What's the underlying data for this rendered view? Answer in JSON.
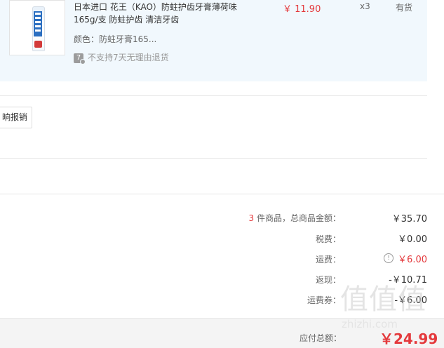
{
  "product": {
    "title_line1": "日本进口 花王（KAO）防蛀护齿牙膏薄荷味",
    "title_line2": "165g/支 防蛀护齿 清洁牙齿",
    "spec": "颜色：防蛀牙膏165...",
    "return_badge": "7",
    "return_note": "不支持7天无理由退货",
    "price": "￥ 11.90",
    "quantity": "x3",
    "stock": "有货"
  },
  "invoice": {
    "button_label": "晌报销"
  },
  "summary": {
    "count": "3",
    "count_suffix": " 件商品，总商品金额：",
    "goods_total": "￥35.70",
    "tax_label": "税费：",
    "tax_value": "￥0.00",
    "freight_label": "运费：",
    "freight_value": "￥6.00",
    "freight_info_icon": "!",
    "rebate_label": "返现：",
    "rebate_value": "-￥10.71",
    "coupon_label": "运费券：",
    "coupon_value": "-￥6.00"
  },
  "footer": {
    "total_label": "应付总额：",
    "total_value": "￥24.99"
  },
  "watermark": {
    "logo": "值值值",
    "text": "zhizhi.com"
  },
  "colors": {
    "accent_red": "#e4393c",
    "product_bg": "#f1f8fd",
    "footer_bg": "#f4f4f4"
  },
  "icons": [
    "toothpaste-product-image",
    "no-7day-return-icon",
    "freight-info-icon"
  ]
}
